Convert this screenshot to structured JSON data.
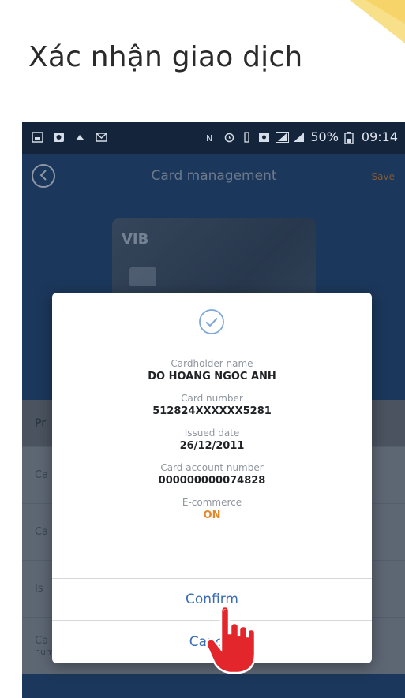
{
  "heading": "Xác nhận giao dịch",
  "status_bar": {
    "battery_percent": "50%",
    "time": "09:14"
  },
  "app_bar": {
    "title": "Card management",
    "save_label": "Save"
  },
  "card_preview": {
    "logo": "VIB"
  },
  "background_list": {
    "header": "Pr",
    "rows": [
      "Ca",
      "Ca",
      "Is",
      "Ca"
    ],
    "last_row_sub": "number"
  },
  "dialog": {
    "fields": [
      {
        "label": "Cardholder name",
        "value": "DO HOANG NGOC ANH"
      },
      {
        "label": "Card number",
        "value": "512824XXXXXX5281"
      },
      {
        "label": "Issued date",
        "value": "26/12/2011"
      },
      {
        "label": "Card account number",
        "value": "000000000074828"
      },
      {
        "label": "E-commerce",
        "value": "ON"
      }
    ],
    "confirm_label": "Confirm",
    "cancel_label": "Cancel"
  },
  "colors": {
    "accent_blue": "#3b6db2",
    "status_on": "#e08a2c",
    "save_orange": "#c7803e",
    "phone_bg": "#254a7a"
  }
}
